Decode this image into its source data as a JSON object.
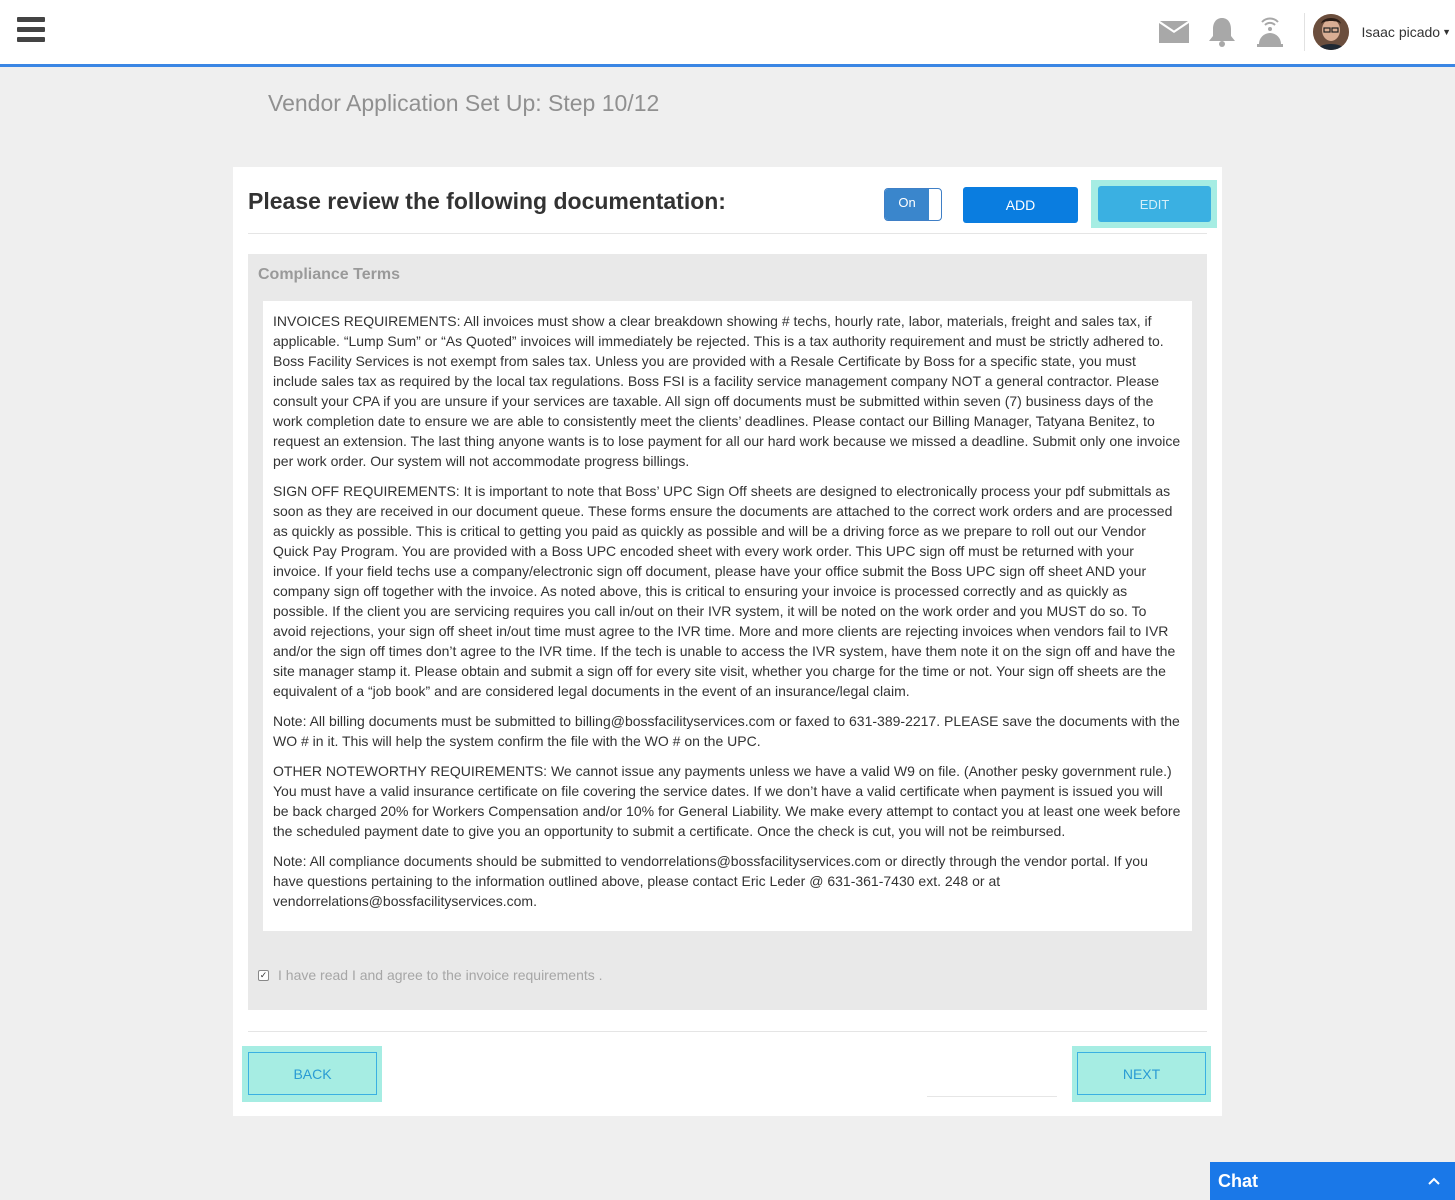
{
  "header": {
    "user_name": "Isaac picado",
    "icons": [
      "menu-icon",
      "mail-icon",
      "bell-icon",
      "service-bell-icon",
      "avatar",
      "chevron-down-icon"
    ]
  },
  "page_title": "Vendor Application Set Up: Step 10/12",
  "card": {
    "heading": "Please review the following documentation:",
    "toggle_label": "On",
    "add_label": "ADD",
    "edit_label": "EDIT"
  },
  "terms": {
    "title": "Compliance Terms",
    "paragraphs": [
      "INVOICES REQUIREMENTS: All invoices must show a clear breakdown showing # techs, hourly rate, labor, materials, freight and sales tax, if applicable. “Lump Sum” or “As Quoted” invoices will immediately be rejected. This is a tax authority requirement and must be strictly adhered to. Boss Facility Services is not exempt from sales tax. Unless you are provided with a Resale Certificate by Boss for a specific state, you must include sales tax as required by the local tax regulations. Boss FSI is a facility service management company NOT a general contractor. Please consult your CPA if you are unsure if your services are taxable. All sign off documents must be submitted within seven (7) business days of the work completion date to ensure we are able to consistently meet the clients’ deadlines. Please contact our Billing Manager, Tatyana Benitez, to request an extension. The last thing anyone wants is to lose payment for all our hard work because we missed a deadline. Submit only one invoice per work order. Our system will not accommodate progress billings.",
      "SIGN OFF REQUIREMENTS: It is important to note that Boss’ UPC Sign Off sheets are designed to electronically process your pdf submittals as soon as they are received in our document queue. These forms ensure the documents are attached to the correct work orders and are processed as quickly as possible. This is critical to getting you paid as quickly as possible and will be a driving force as we prepare to roll out our Vendor Quick Pay Program. You are provided with a Boss UPC encoded sheet with every work order. This UPC sign off must be returned with your invoice. If your field techs use a company/electronic sign off document, please have your office submit the Boss UPC sign off sheet AND your company sign off together with the invoice. As noted above, this is critical to ensuring your invoice is processed correctly and as quickly as possible. If the client you are servicing requires you call in/out on their IVR system, it will be noted on the work order and you MUST do so. To avoid rejections, your sign off sheet in/out time must agree to the IVR time. More and more clients are rejecting invoices when vendors fail to IVR and/or the sign off times don’t agree to the IVR time. If the tech is unable to access the IVR system, have them note it on the sign off and have the site manager stamp it. Please obtain and submit a sign off for every site visit, whether you charge for the time or not. Your sign off sheets are the equivalent of a “job book” and are considered legal documents in the event of an insurance/legal claim.",
      "Note: All billing documents must be submitted to billing@bossfacilityservices.com or faxed to 631-389-2217. PLEASE save the documents with the WO # in it. This will help the system confirm the file with the WO # on the UPC.",
      "OTHER NOTEWORTHY REQUIREMENTS: We cannot issue any payments unless we have a valid W9 on file. (Another pesky government rule.) You must have a valid insurance certificate on file covering the service dates. If we don’t have a valid certificate when payment is issued you will be back charged 20% for Workers Compensation and/or 10% for General Liability. We make every attempt to contact you at least one week before the scheduled payment date to give you an opportunity to submit a certificate. Once the check is cut, you will not be reimbursed.",
      "Note: All compliance documents should be submitted to vendorrelations@bossfacilityservices.com or directly through the vendor portal. If you have questions pertaining to the information outlined above, please contact Eric Leder @ 631-361-7430 ext. 248 or at vendorrelations@bossfacilityservices.com."
    ],
    "agree_label": "I have read I and agree to the invoice requirements .",
    "agree_checked": true
  },
  "footer": {
    "back_label": "BACK",
    "next_label": "NEXT"
  },
  "chat": {
    "label": "Chat"
  },
  "colors": {
    "accent_blue": "#0a7de0",
    "header_border": "#3a86e4",
    "highlight": "#a6ede3",
    "chat_bar": "#1a78e8"
  }
}
